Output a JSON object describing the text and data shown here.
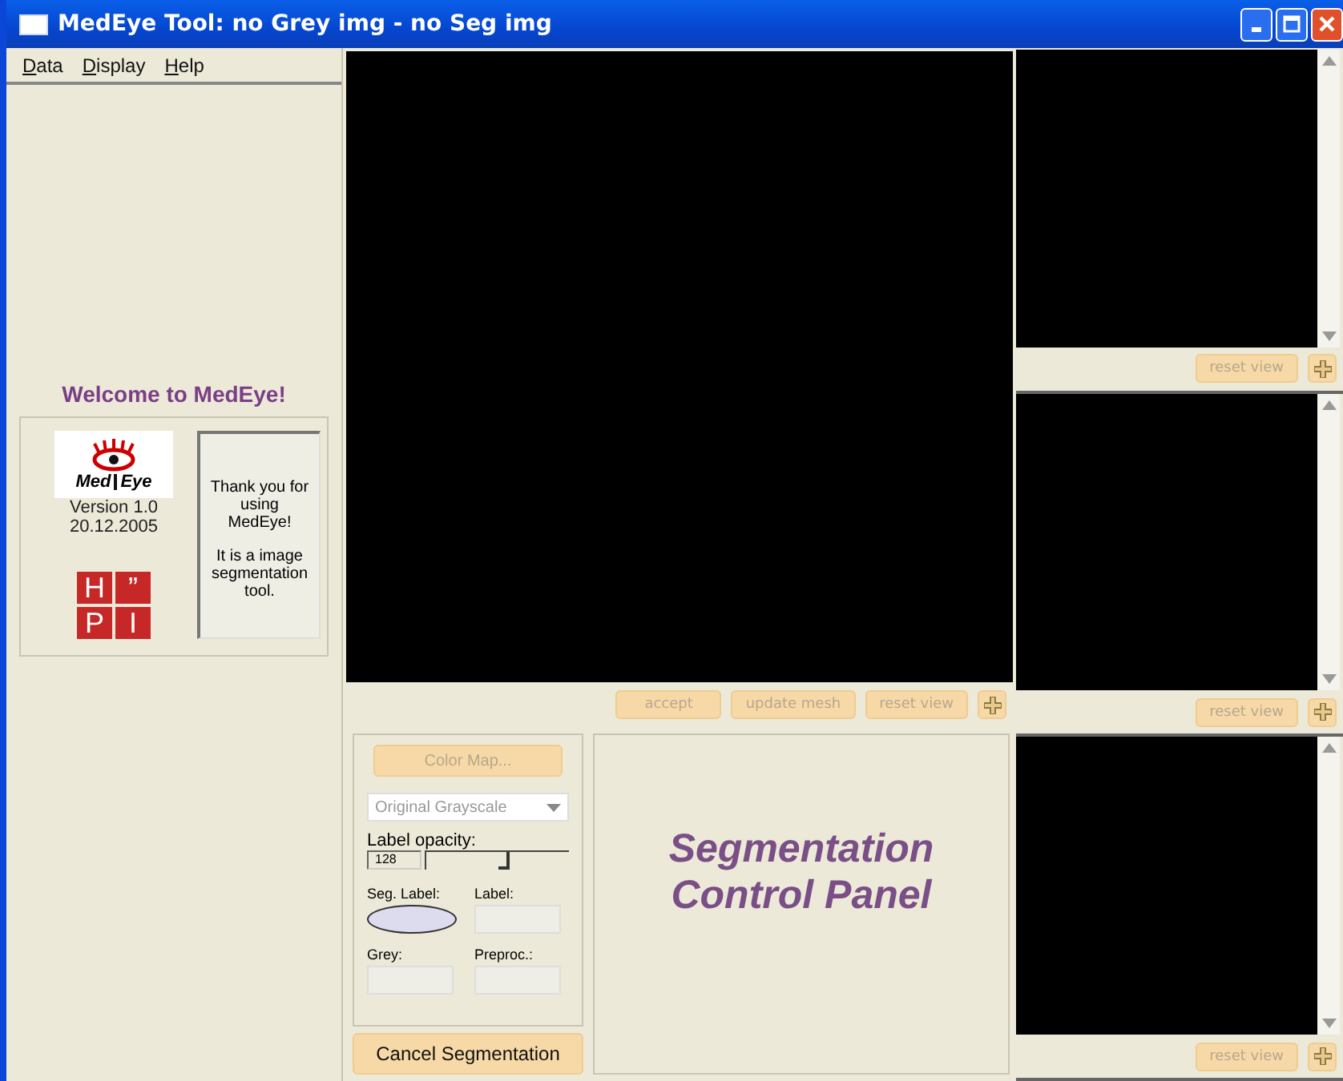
{
  "window": {
    "title": "MedEye Tool: no Grey img - no Seg img"
  },
  "menu": [
    {
      "mnemonic": "D",
      "rest": "ata"
    },
    {
      "mnemonic": "D",
      "rest": "isplay"
    },
    {
      "mnemonic": "H",
      "rest": "elp"
    }
  ],
  "welcome": {
    "heading": "Welcome to MedEye!",
    "logo": {
      "left": "Med",
      "right": "Eye"
    },
    "version": "Version 1.0",
    "date": "20.12.2005",
    "hpi_logo": [
      "H",
      "”",
      "P",
      "I"
    ],
    "message_paragraphs": [
      [
        "Thank you for",
        "using",
        "MedEye!"
      ],
      [
        "It is a image",
        "segmentation",
        "tool."
      ]
    ]
  },
  "main_view": {
    "buttons": [
      {
        "label": "accept",
        "disabled": true
      },
      {
        "label": "update mesh",
        "disabled": true
      },
      {
        "label": "reset view",
        "disabled": true
      }
    ]
  },
  "controls": {
    "color_map": {
      "label": "Color Map...",
      "disabled": true
    },
    "lookup": {
      "value": "Original Grayscale",
      "disabled": true
    },
    "opacity": {
      "label": "Label opacity:",
      "value": "128",
      "level": 0.5
    },
    "seg_label": "Seg. Label:",
    "label_field": "Label:",
    "grey_field": "Grey:",
    "preproc_field": "Preproc.:",
    "cancel": {
      "label": "Cancel Segmentation",
      "disabled": false
    }
  },
  "panel_title": [
    "Segmentation",
    "Control Panel"
  ],
  "side_views": [
    {
      "reset": {
        "label": "reset view",
        "disabled": true
      }
    },
    {
      "reset": {
        "label": "reset view",
        "disabled": true
      }
    },
    {
      "reset": {
        "label": "reset view",
        "disabled": true
      }
    }
  ]
}
